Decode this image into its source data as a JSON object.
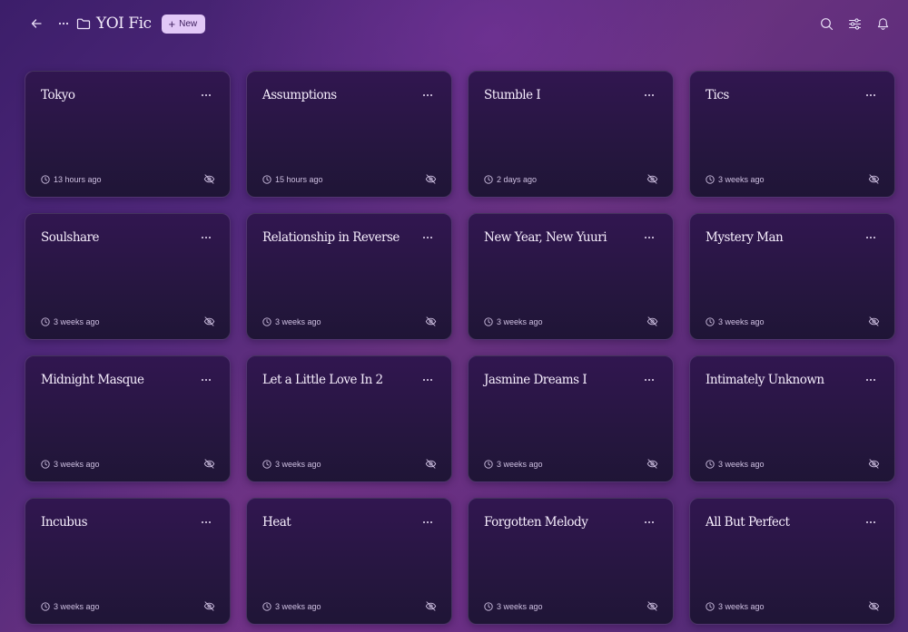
{
  "header": {
    "back_icon": "arrow-left-icon",
    "more_icon": "ellipsis-icon",
    "folder_icon": "folder-icon",
    "title": "YOI Fic",
    "new_label": "New",
    "search_icon": "search-icon",
    "filter_icon": "sliders-icon",
    "notifications_icon": "bell-icon"
  },
  "cards": [
    {
      "title": "Tokyo",
      "time": "13 hours ago"
    },
    {
      "title": "Assumptions",
      "time": "15 hours ago"
    },
    {
      "title": "Stumble I",
      "time": "2 days ago"
    },
    {
      "title": "Tics",
      "time": "3 weeks ago"
    },
    {
      "title": "Soulshare",
      "time": "3 weeks ago"
    },
    {
      "title": "Relationship in Reverse",
      "time": "3 weeks ago"
    },
    {
      "title": "New Year, New Yuuri",
      "time": "3 weeks ago"
    },
    {
      "title": "Mystery Man",
      "time": "3 weeks ago"
    },
    {
      "title": "Midnight Masque",
      "time": "3 weeks ago"
    },
    {
      "title": "Let a Little Love In 2",
      "time": "3 weeks ago"
    },
    {
      "title": "Jasmine Dreams I",
      "time": "3 weeks ago"
    },
    {
      "title": "Intimately Unknown",
      "time": "3 weeks ago"
    },
    {
      "title": "Incubus",
      "time": "3 weeks ago"
    },
    {
      "title": "Heat",
      "time": "3 weeks ago"
    },
    {
      "title": "Forgotten Melody",
      "time": "3 weeks ago"
    },
    {
      "title": "All But Perfect",
      "time": "3 weeks ago"
    }
  ],
  "card_icons": {
    "more": "ellipsis-icon",
    "time": "clock-icon",
    "visibility": "eye-off-icon"
  }
}
